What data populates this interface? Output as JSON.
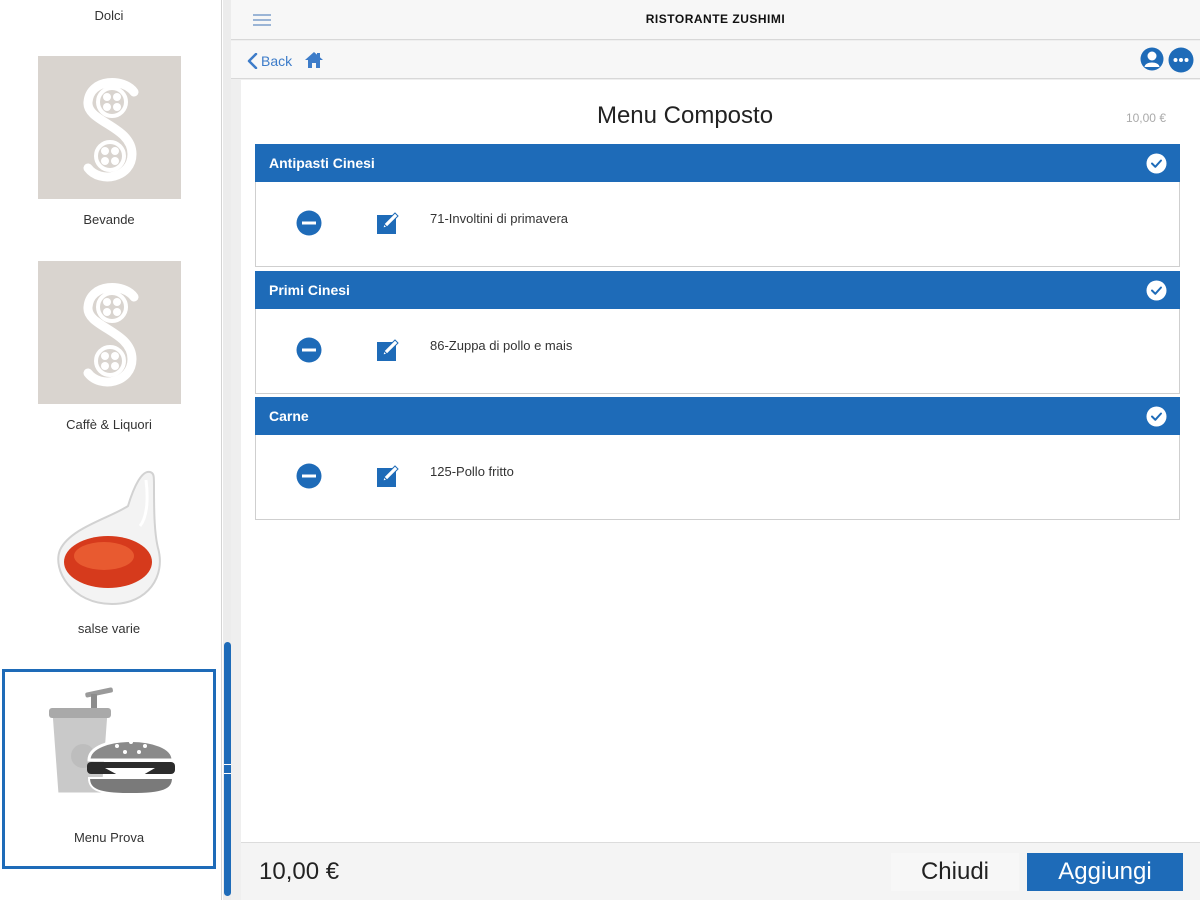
{
  "sidebar": {
    "items": [
      {
        "label": "Dolci",
        "image": "logo-s-icon"
      },
      {
        "label": "Bevande",
        "image": "logo-s-icon"
      },
      {
        "label": "Caffè & Liquori",
        "image": "logo-s-icon"
      },
      {
        "label": "salse varie",
        "image": "sauce-spoon-image"
      },
      {
        "label": "Menu Prova",
        "image": "fastfood-menu-icon",
        "selected": true
      }
    ]
  },
  "header": {
    "title": "RISTORANTE ZUSHIMI",
    "back_label": "Back"
  },
  "menu": {
    "title": "Menu Composto",
    "price": "10,00 €",
    "sections": [
      {
        "header": "Antipasti Cinesi",
        "item": "71-Involtini di primavera"
      },
      {
        "header": "Primi Cinesi",
        "item": "86-Zuppa di pollo e mais"
      },
      {
        "header": "Carne",
        "item": "125-Pollo fritto"
      }
    ]
  },
  "footer": {
    "total": "10,00 €",
    "close_label": "Chiudi",
    "add_label": "Aggiungi"
  },
  "colors": {
    "accent": "#1e6bb8",
    "tile_bg": "#d9d4cf"
  }
}
